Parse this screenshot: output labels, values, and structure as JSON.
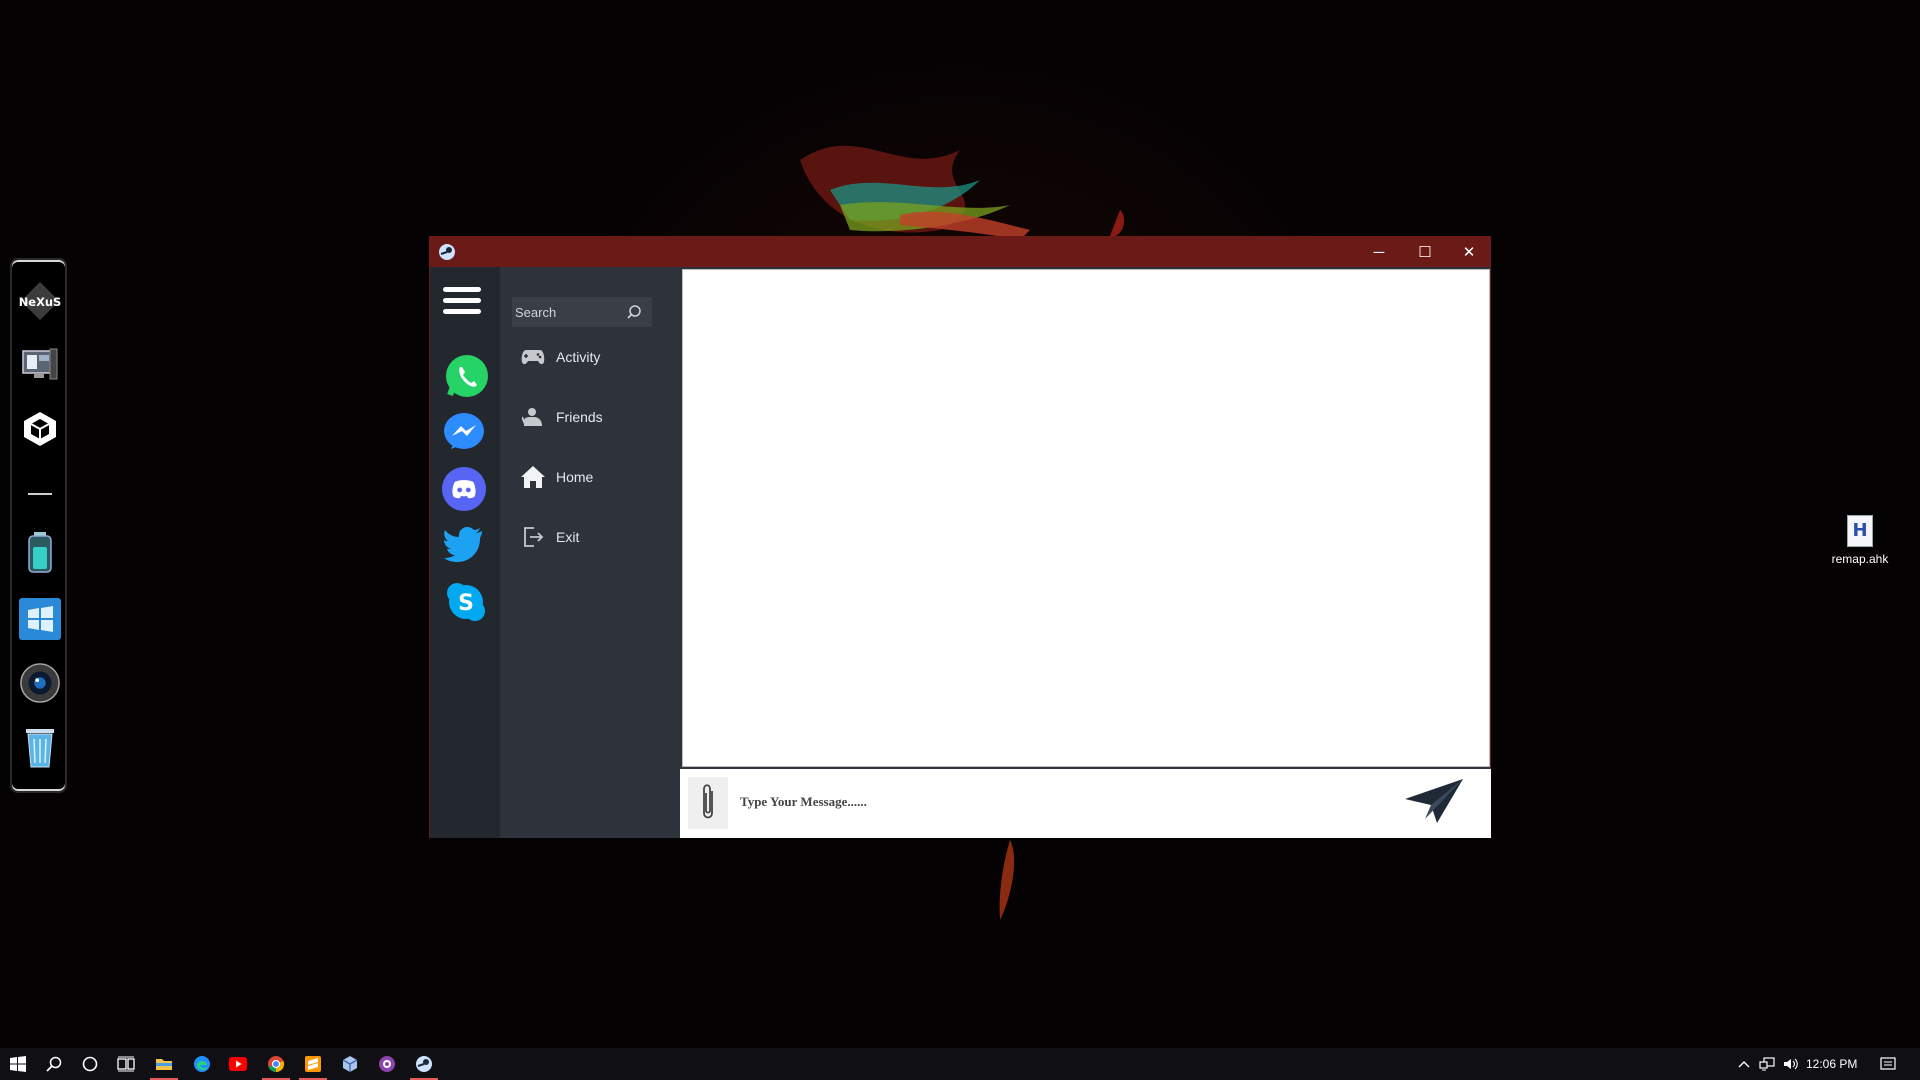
{
  "desktop": {
    "icons": [
      {
        "label": "remap.ahk",
        "glyph": "H"
      }
    ]
  },
  "dock": {
    "items": [
      {
        "name": "nexus-logo-icon",
        "text": "NeXuS"
      },
      {
        "name": "monitor-icon"
      },
      {
        "name": "unity-icon"
      },
      {
        "name": "separator"
      },
      {
        "name": "battery-icon"
      },
      {
        "name": "windows-logo-icon"
      },
      {
        "name": "webcam-icon"
      },
      {
        "name": "recycle-bin-icon"
      }
    ]
  },
  "window": {
    "title_icon": "steam-icon",
    "controls": {
      "minimize": "─",
      "maximize": "☐",
      "close": "✕"
    },
    "rail_apps": [
      "whatsapp-icon",
      "messenger-icon",
      "discord-icon",
      "twitter-icon",
      "skype-icon"
    ],
    "search": {
      "placeholder": "Search"
    },
    "nav": [
      {
        "label": "Activity",
        "icon": "gamepad-icon"
      },
      {
        "label": "Friends",
        "icon": "user-icon"
      },
      {
        "label": "Home",
        "icon": "home-icon"
      },
      {
        "label": "Exit",
        "icon": "exit-icon"
      }
    ],
    "composer": {
      "placeholder": "Type Your Message......"
    }
  },
  "taskbar": {
    "clock": "12:06 PM",
    "apps": [
      "start-icon",
      "search-icon",
      "cortana-icon",
      "task-view-icon",
      "file-explorer-icon",
      "edge-icon",
      "youtube-icon",
      "chrome-icon",
      "sublime-icon",
      "virtualbox-icon",
      "github-desktop-icon",
      "steam-icon"
    ]
  },
  "colors": {
    "titlebar": "#6b1b17",
    "rail": "#23272e",
    "navpanel": "#2e333b",
    "whatsapp": "#25d366",
    "messenger": "#2d8cff",
    "discord": "#5865f2",
    "twitter": "#1da1f2",
    "skype": "#00a9f0"
  }
}
